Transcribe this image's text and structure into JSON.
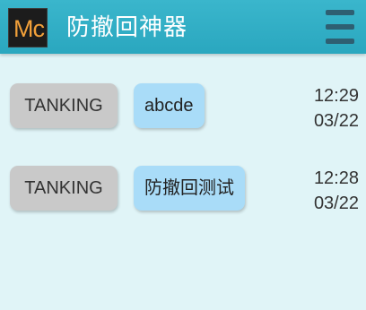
{
  "header": {
    "logo_text": "Mc",
    "title": "防撤回神器",
    "menu_icon": "hamburger-menu-icon",
    "background_color": "#2fb0c6"
  },
  "messages": [
    {
      "sender": "TANKING",
      "content": "abcde",
      "time": "12:29",
      "date": "03/22"
    },
    {
      "sender": "TANKING",
      "content": "防撤回测试",
      "time": "12:28",
      "date": "03/22"
    }
  ],
  "colors": {
    "page_background": "#e0f4f7",
    "sender_bubble": "#c9c9c9",
    "content_bubble": "#a9dcf8",
    "logo_text": "#f1a03a"
  }
}
